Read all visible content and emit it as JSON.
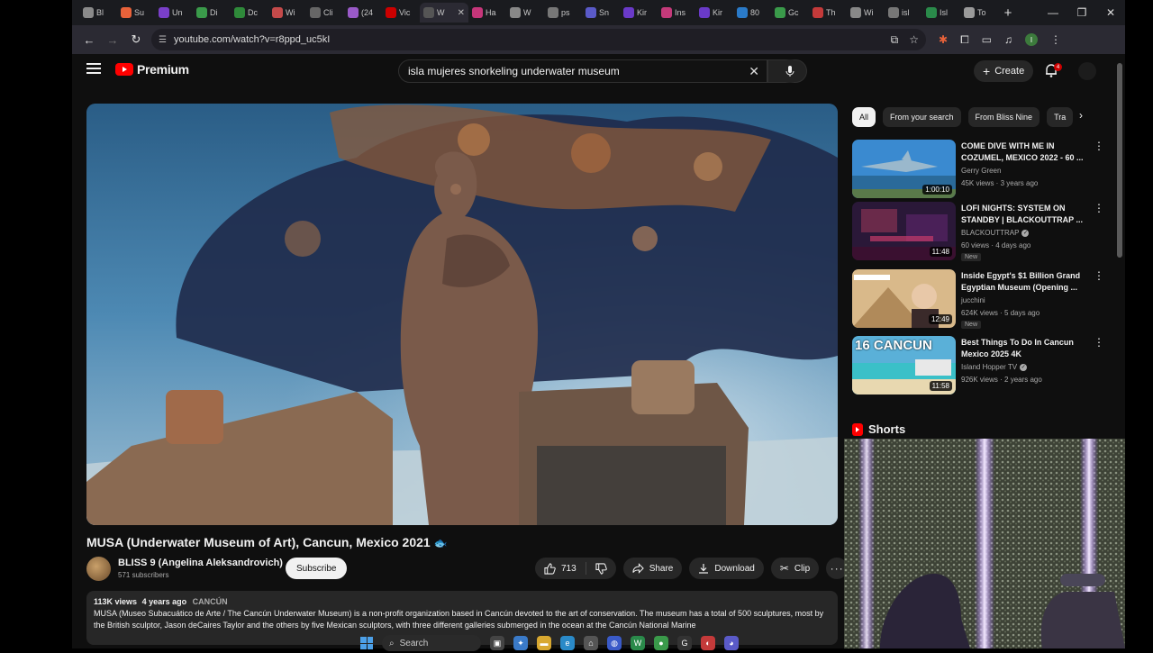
{
  "browser": {
    "tabs": [
      {
        "label": "Bl",
        "color": "#8a8a8a"
      },
      {
        "label": "Su",
        "color": "#e8623a"
      },
      {
        "label": "Un",
        "color": "#7a3fc9"
      },
      {
        "label": "Di",
        "color": "#3a9a4a"
      },
      {
        "label": "Dc",
        "color": "#2f8a3a"
      },
      {
        "label": "Wi",
        "color": "#c44a4a"
      },
      {
        "label": "Cli",
        "color": "#666666"
      },
      {
        "label": "(24",
        "color": "#9a5ac8"
      },
      {
        "label": "Vic",
        "color": "#cc0000"
      },
      {
        "label": "W",
        "color": "#555555",
        "active": true
      },
      {
        "label": "Ha",
        "color": "#c6367a"
      },
      {
        "label": "W",
        "color": "#888888"
      },
      {
        "label": "ps",
        "color": "#777777"
      },
      {
        "label": "Sn",
        "color": "#5a5ac8"
      },
      {
        "label": "Kir",
        "color": "#6a3ac8"
      },
      {
        "label": "Ins",
        "color": "#c43a7a"
      },
      {
        "label": "Kir",
        "color": "#6a3ac8"
      },
      {
        "label": "80",
        "color": "#2a7ac8"
      },
      {
        "label": "Gc",
        "color": "#3a9a4a"
      },
      {
        "label": "Th",
        "color": "#c43a3a"
      },
      {
        "label": "Wi",
        "color": "#888888"
      },
      {
        "label": "isl",
        "color": "#777777"
      },
      {
        "label": "Isl",
        "color": "#2a8a4a"
      },
      {
        "label": "To",
        "color": "#9a9a9a"
      }
    ],
    "new_tab": "+",
    "url": "youtube.com/watch?v=r8ppd_uc5kI"
  },
  "yt": {
    "logo_text": "Premium",
    "search_query": "isla mujeres snorkeling underwater museum",
    "create_label": "Create",
    "notif_count": "4"
  },
  "video": {
    "title": "MUSA (Underwater Museum of Art), Cancun, Mexico 2021",
    "title_emoji": "🐟",
    "channel": "BLISS 9 (Angelina Aleksandrovich)",
    "subscribers": "571 subscribers",
    "subscribe_label": "Subscribe",
    "likes": "713",
    "share_label": "Share",
    "download_label": "Download",
    "clip_label": "Clip",
    "views": "113K views",
    "age": "4 years ago",
    "tag": "CANCÚN",
    "description": "MUSA (Museo Subacuático de Arte / The Cancún Underwater Museum) is a non-profit organization based in Cancún devoted to the art of conservation. The museum has a total of 500 sculptures, most by the British sculptor, Jason deCaires Taylor and the others by five Mexican sculptors, with three different galleries submerged in the ocean at the Cancún National Marine"
  },
  "chips": [
    "All",
    "From your search",
    "From Bliss Nine",
    "Tra"
  ],
  "recommendations": [
    {
      "title": "COME DIVE WITH ME IN COZUMEL, MEXICO 2022 - 60 ...",
      "channel": "Gerry Green",
      "verified": false,
      "views": "45K views · 3 years ago",
      "duration": "1:00:10",
      "new": "",
      "thumb": "shark"
    },
    {
      "title": "LOFI NIGHTS: SYSTEM ON STANDBY | BLACKOUTTRAP ...",
      "channel": "BLACKOUTTRAP",
      "verified": true,
      "views": "60 views · 4 days ago",
      "duration": "11:48",
      "new": "New",
      "thumb": "lofi"
    },
    {
      "title": "Inside Egypt's $1 Billion Grand Egyptian Museum (Opening ...",
      "channel": "jucchini",
      "verified": false,
      "views": "624K views · 5 days ago",
      "duration": "12:49",
      "new": "New",
      "thumb": "egypt"
    },
    {
      "title": "Best Things To Do In Cancun Mexico 2025 4K",
      "channel": "Island Hopper TV",
      "verified": true,
      "views": "926K views · 2 years ago",
      "duration": "11:58",
      "new": "",
      "thumb": "cancun",
      "thumb_text": "16 CANCUN"
    }
  ],
  "shorts_label": "Shorts",
  "taskbar": {
    "search_label": "Search"
  }
}
